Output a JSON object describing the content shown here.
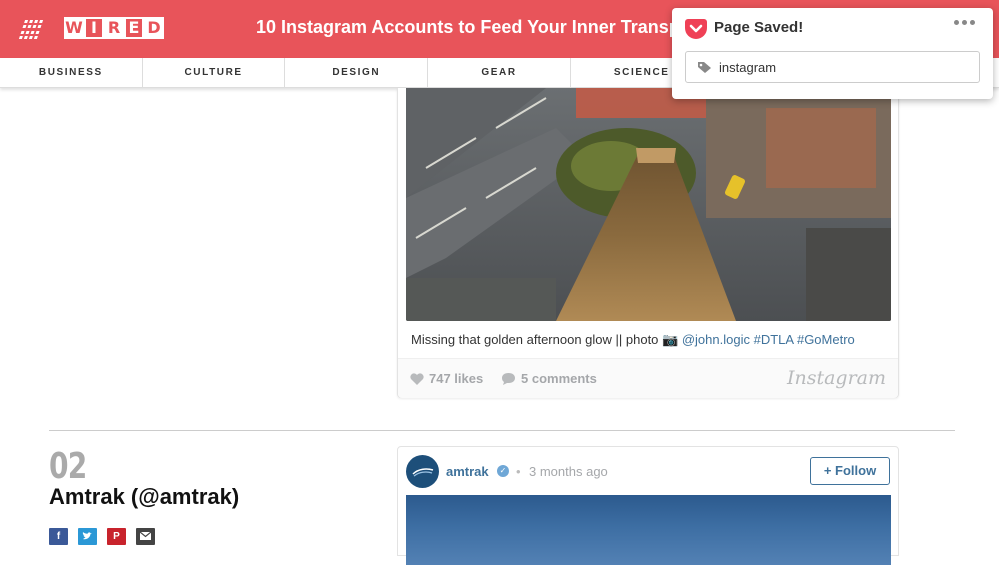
{
  "header": {
    "logo_letters": [
      "W",
      "I",
      "R",
      "E",
      "D"
    ],
    "headline": "10 Instagram Accounts to Feed Your Inner Transporta",
    "brand_color": "#e8545a"
  },
  "nav": {
    "items": [
      "BUSINESS",
      "CULTURE",
      "DESIGN",
      "GEAR",
      "SCIENCE",
      "",
      "",
      ""
    ]
  },
  "post1": {
    "caption_text": "Missing that golden afternoon glow || photo 📷",
    "caption_tags": [
      "@john.logic",
      "#DTLA",
      "#GoMetro"
    ],
    "likes": "747 likes",
    "comments": "5 comments",
    "wordmark": "Instagram"
  },
  "section2": {
    "number": "02",
    "title": "Amtrak (@amtrak)",
    "share_icons": [
      "facebook-icon",
      "twitter-icon",
      "pinterest-icon",
      "email-icon"
    ]
  },
  "post2": {
    "username": "amtrak",
    "separator": "•",
    "time_ago": "3 months ago",
    "follow_label": "+ Follow"
  },
  "pocket": {
    "title": "Page Saved!",
    "tag_value": "instagram",
    "accent_color": "#ef4056"
  }
}
